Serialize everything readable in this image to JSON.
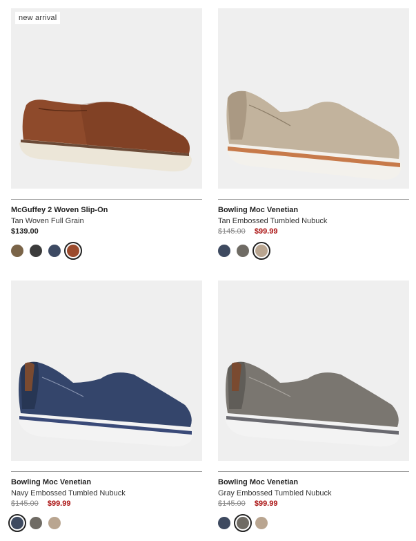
{
  "products": [
    {
      "badge": "new arrival",
      "name": "McGuffey 2 Woven Slip-On",
      "color": "Tan Woven Full Grain",
      "price": "$139.00",
      "swatches": [
        {
          "name": "brown-olive",
          "color": "#7a6448",
          "selected": false
        },
        {
          "name": "black",
          "color": "#3b3b3b",
          "selected": false
        },
        {
          "name": "navy",
          "color": "#3d4a63",
          "selected": false
        },
        {
          "name": "tan",
          "color": "#9b4a2c",
          "selected": true
        }
      ]
    },
    {
      "badge": "",
      "name": "Bowling Moc Venetian",
      "color": "Tan Embossed Tumbled Nubuck",
      "old_price": "$145.00",
      "sale_price": "$99.99",
      "swatches": [
        {
          "name": "navy",
          "color": "#3e4a60",
          "selected": false
        },
        {
          "name": "gray",
          "color": "#6f6b64",
          "selected": false
        },
        {
          "name": "tan",
          "color": "#b9a590",
          "selected": true
        }
      ]
    },
    {
      "badge": "",
      "name": "Bowling Moc Venetian",
      "color": "Navy Embossed Tumbled Nubuck",
      "old_price": "$145.00",
      "sale_price": "$99.99",
      "swatches": [
        {
          "name": "navy",
          "color": "#3e4a60",
          "selected": true
        },
        {
          "name": "gray",
          "color": "#6f6b64",
          "selected": false
        },
        {
          "name": "tan",
          "color": "#b9a590",
          "selected": false
        }
      ]
    },
    {
      "badge": "",
      "name": "Bowling Moc Venetian",
      "color": "Gray Embossed Tumbled Nubuck",
      "old_price": "$145.00",
      "sale_price": "$99.99",
      "swatches": [
        {
          "name": "navy",
          "color": "#3e4a60",
          "selected": false
        },
        {
          "name": "gray",
          "color": "#6f6b64",
          "selected": true
        },
        {
          "name": "tan",
          "color": "#b9a590",
          "selected": false
        }
      ]
    }
  ],
  "shoe_colors": {
    "p0": {
      "upper": "#8e4a2b",
      "upper_dark": "#6a3219",
      "sole": "#ece6d8",
      "welt": "#6b4a36"
    },
    "p1": {
      "upper": "#c2b39d",
      "upper_dark": "#9f8f78",
      "sole": "#f3f1ec",
      "welt": "#c77a4a"
    },
    "p2": {
      "upper": "#34456b",
      "upper_dark": "#24324f",
      "sole": "#f3f3f3",
      "welt": "#3a4a78"
    },
    "p3": {
      "upper": "#7a7670",
      "upper_dark": "#5a5752",
      "sole": "#f3f3f3",
      "welt": "#6a6a70"
    }
  }
}
